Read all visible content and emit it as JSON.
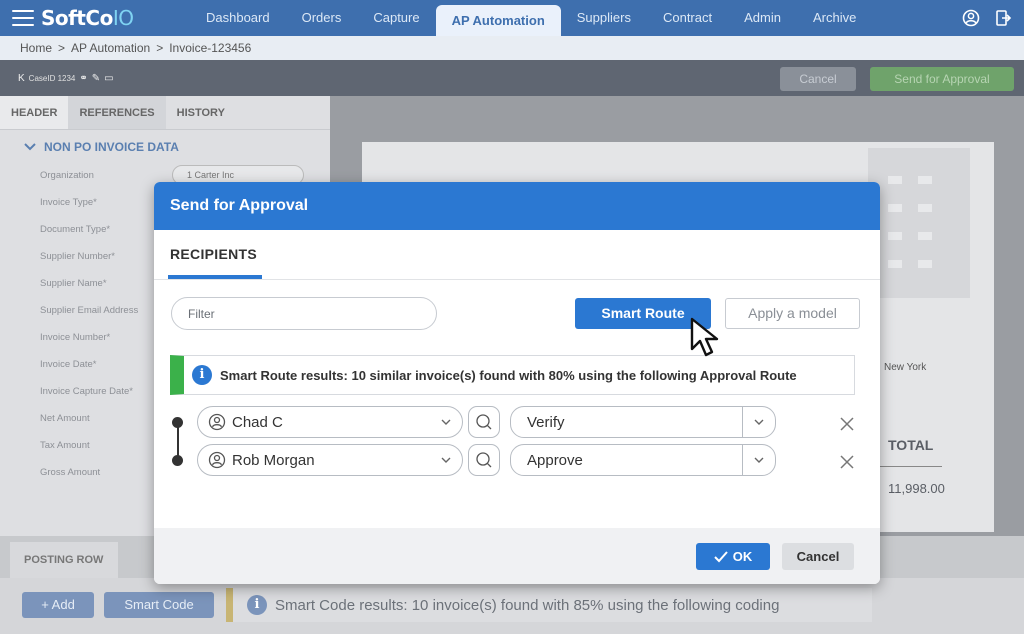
{
  "app": {
    "logo_main": "SoftCo",
    "logo_suffix": "IO",
    "nav_tabs": [
      "Dashboard",
      "Orders",
      "Capture",
      "AP Automation",
      "Suppliers",
      "Contract",
      "Admin",
      "Archive"
    ],
    "active_tab": "AP Automation",
    "icons": [
      "hamburger-icon",
      "user-circle-icon",
      "logout-icon"
    ]
  },
  "breadcrumb": {
    "items": [
      "Home",
      "AP Automation",
      "Invoice-123456"
    ],
    "separator": ">"
  },
  "toolbar": {
    "case_id": "CaseID 1234",
    "cancel_label": "Cancel",
    "send_label": "Send for Approval"
  },
  "left_panel": {
    "tabs": [
      "HEADER",
      "REFERENCES",
      "HISTORY"
    ],
    "section_title": "NON PO INVOICE DATA",
    "fields": [
      {
        "label": "Organization",
        "value": "1 Carter Inc"
      },
      {
        "label": "Invoice Type*",
        "value": ""
      },
      {
        "label": "Document Type*",
        "value": ""
      },
      {
        "label": "Supplier Number*",
        "value": ""
      },
      {
        "label": "Supplier Name*",
        "value": ""
      },
      {
        "label": "Supplier Email Address",
        "value": ""
      },
      {
        "label": "Invoice Number*",
        "value": ""
      },
      {
        "label": "Invoice Date*",
        "value": ""
      },
      {
        "label": "Invoice Capture Date*",
        "value": ""
      },
      {
        "label": "Net Amount",
        "value": ""
      },
      {
        "label": "Tax Amount",
        "value": ""
      },
      {
        "label": "Gross Amount",
        "value": ""
      }
    ]
  },
  "document": {
    "city_text": "New York",
    "total_label": "TOTAL",
    "total_amount": "11,998.00"
  },
  "posting": {
    "tab_label": "POSTING ROW",
    "add_label": "+ Add",
    "smart_code_label": "Smart Code",
    "smart_code_result": "Smart Code results: 10 invoice(s) found with 85% using the following coding"
  },
  "modal": {
    "title": "Send for Approval",
    "tab_label": "RECIPIENTS",
    "filter_placeholder": "Filter",
    "smart_route_label": "Smart Route",
    "apply_model_label": "Apply a model",
    "result_text": "Smart Route results: 10 similar invoice(s) found with 80% using the following Approval Route",
    "recipients": [
      {
        "user": "Chad C",
        "action": "Verify"
      },
      {
        "user": "Rob Morgan",
        "action": "Approve"
      }
    ],
    "ok_label": "OK",
    "cancel_label": "Cancel"
  },
  "colors": {
    "nav_blue": "#3e6fae",
    "accent_blue": "#2b78d2",
    "success_green": "#3bb14a",
    "send_green": "#6fa36b"
  }
}
